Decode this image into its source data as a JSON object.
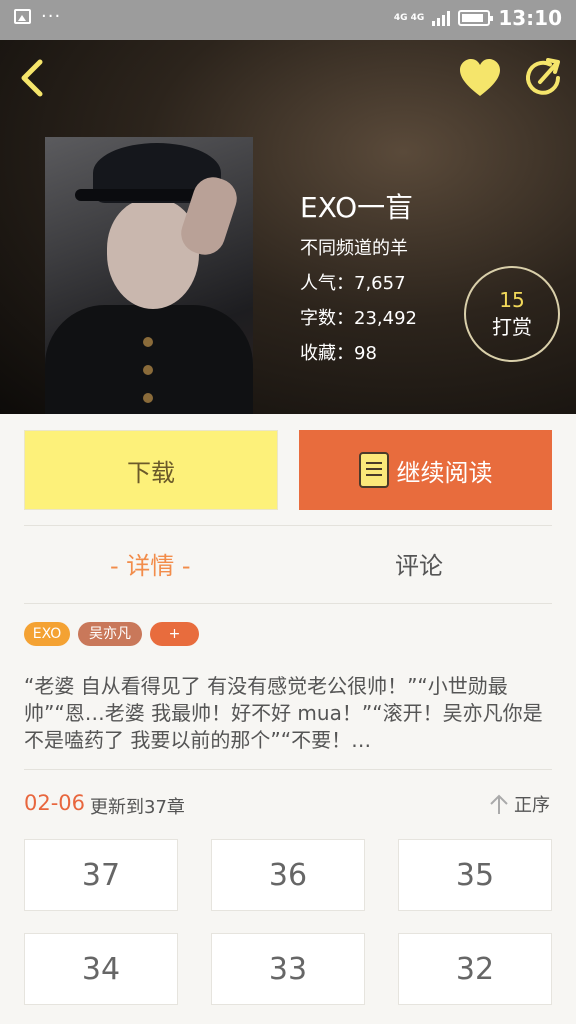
{
  "status_bar": {
    "network": "4G 4G",
    "time": "13:10",
    "battery_level": 0.85,
    "icons": [
      "gallery-icon",
      "more-dots-icon",
      "signal-icon",
      "battery-icon"
    ]
  },
  "header": {
    "icons": [
      "back-arrow-icon",
      "heart-icon",
      "share-icon"
    ],
    "book": {
      "title": "EXO一盲",
      "author": "不同频道的羊",
      "popularity": "人气：7,657",
      "word_count": "字数：23,492",
      "favorites": "收藏：98"
    },
    "reward": {
      "count": "15",
      "label": "打赏"
    }
  },
  "actions": {
    "download_label": "下载",
    "continue_label": "继续阅读"
  },
  "tabs": {
    "details_label": "- 详情 -",
    "comments_label": "评论",
    "active": "details"
  },
  "tags": [
    {
      "label": "EXO",
      "color": "#f4a233"
    },
    {
      "label": "吴亦凡",
      "color": "#c9785a"
    },
    {
      "label": "+",
      "color": "#e86c3d"
    }
  ],
  "synopsis": "“老婆  自从看得见了  有没有感觉老公很帅！”“小世勋最帅”“恩…老婆   我最帅！好不好 mua！”“滚开！吴亦凡你是不是嗑药了  我要以前的那个”“不要！…",
  "update": {
    "date": "02-06",
    "text": "更新到37章",
    "order_label": "正序"
  },
  "chapters": [
    "37",
    "36",
    "35",
    "34",
    "33",
    "32"
  ],
  "colors": {
    "accent_orange": "#e86c3d",
    "download_yellow": "#fdf17a",
    "tab_active": "#f28c4a",
    "reward_gold": "#f2d95a",
    "icon_yellow": "#f5e56b"
  }
}
